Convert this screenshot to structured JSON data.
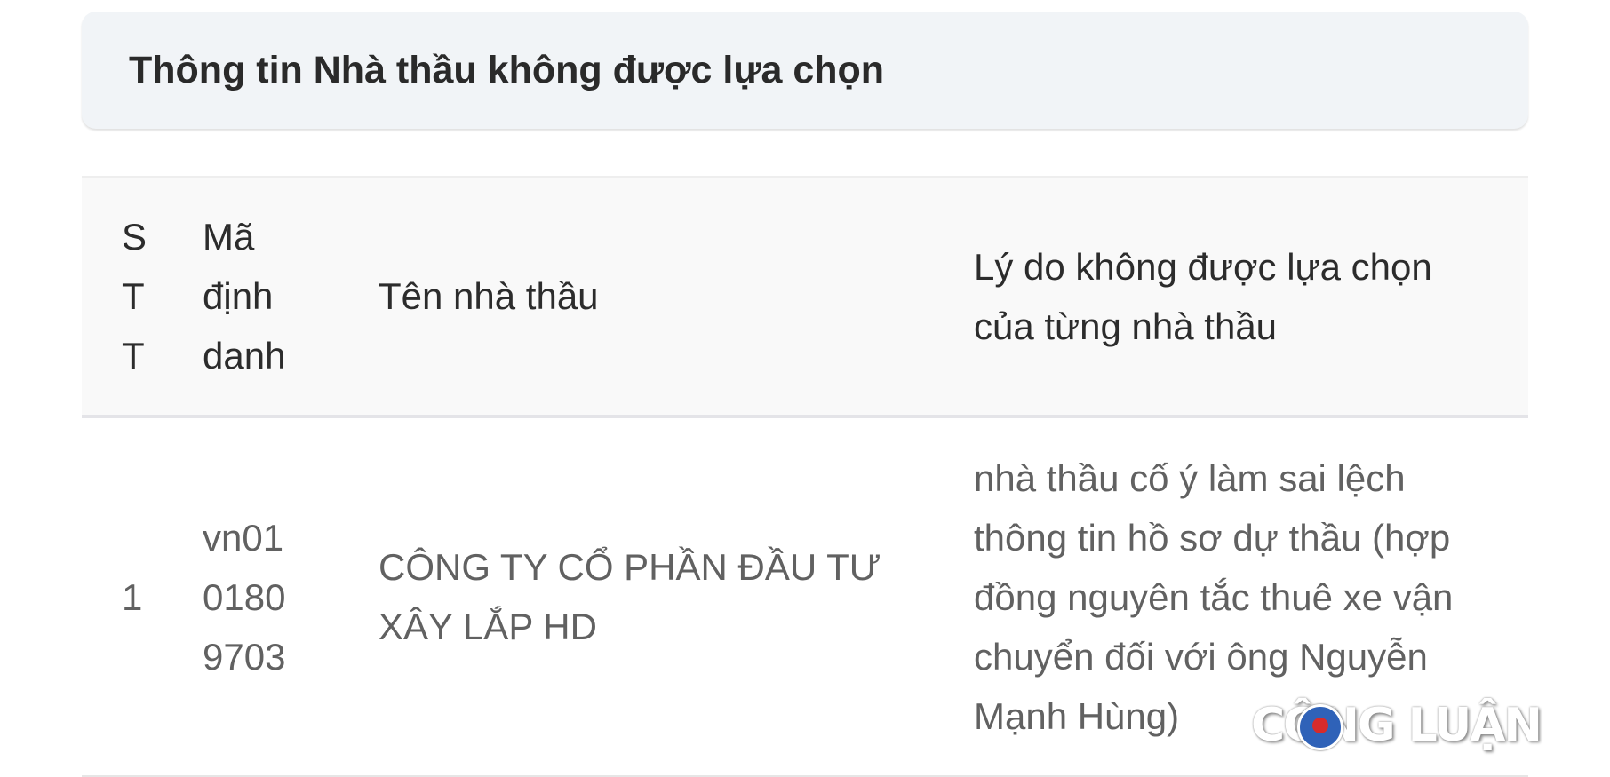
{
  "panel": {
    "title": "Thông tin Nhà thầu không được lựa chọn"
  },
  "table": {
    "headers": {
      "stt": "S\nT\nT",
      "ma": "Mã\nđịnh\ndanh",
      "ten": "Tên nhà thầu",
      "ly_do": "Lý do không được lựa chọn\ncủa từng nhà thầu"
    },
    "rows": [
      {
        "stt": "1",
        "ma": "vn01\n0180\n9703",
        "ten": "CÔNG TY CỔ PHẦN ĐẦU TƯ\nXÂY LẮP HD",
        "ly_do": "nhà thầu cố ý làm sai lệch\nthông tin hồ sơ dự thầu (hợp\nđồng nguyên tắc thuê xe vận\nchuyển đối với ông Nguyễn\nMạnh Hùng)"
      }
    ]
  },
  "watermark": {
    "text": "CÔNG LUẬN"
  }
}
